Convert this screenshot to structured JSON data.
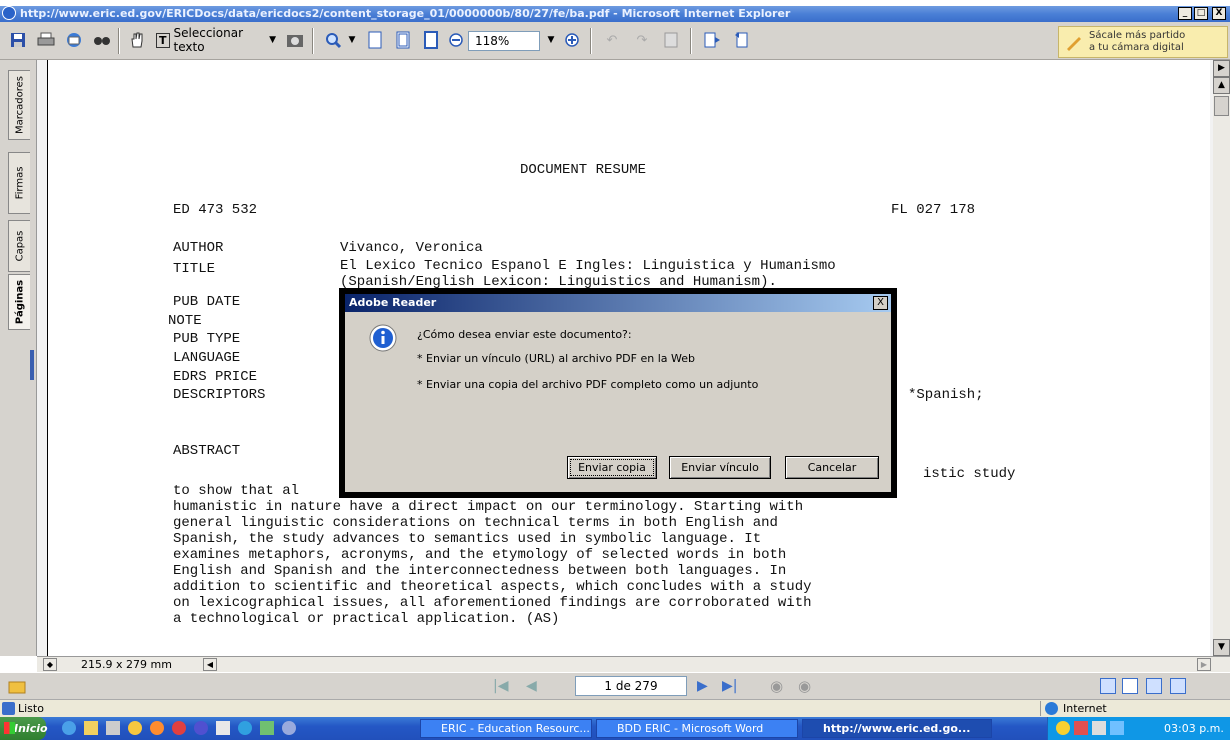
{
  "window": {
    "title": "http://www.eric.ed.gov/ERICDocs/data/ericdocs2/content_storage_01/0000000b/80/27/fe/ba.pdf - Microsoft Internet Explorer",
    "min": "_",
    "max": "□",
    "close": "X"
  },
  "toolbar": {
    "select_text": "Seleccionar texto",
    "zoom": "118%"
  },
  "promo": {
    "line1": "Sácale más partido",
    "line2": "a tu cámara digital"
  },
  "leftnav": {
    "tabs": [
      "Marcadores",
      "Firmas",
      "Capas",
      "Páginas"
    ]
  },
  "document": {
    "heading": "DOCUMENT RESUME",
    "ed_number": "ED 473 532",
    "fl_number": "FL 027 178",
    "fields": [
      {
        "label": "AUTHOR",
        "value": "Vivanco, Veronica"
      },
      {
        "label": "TITLE",
        "value": "El Lexico Tecnico Espanol E Ingles: Linguistica y Humanismo"
      },
      {
        "label": "",
        "value": "(Spanish/English Lexicon: Linguistics and Humanism)."
      },
      {
        "label": "PUB DATE",
        "value": ""
      },
      {
        "label": "NOTE",
        "value": ""
      },
      {
        "label": "PUB TYPE",
        "value": ""
      },
      {
        "label": "LANGUAGE",
        "value": ""
      },
      {
        "label": "EDRS PRICE",
        "value": ""
      },
      {
        "label": "DESCRIPTORS",
        "value": "*Spanish;"
      }
    ],
    "abstract_label": "ABSTRACT",
    "abstract_partial": "istic study",
    "abstract_lines": [
      "to show that al                                          or",
      "humanistic in nature have a direct impact on our terminology. Starting with",
      "general linguistic considerations on technical terms in both English and",
      "Spanish, the study advances to semantics used in symbolic language. It",
      "examines metaphors, acronyms, and the etymology of selected words in both",
      "English and Spanish and the interconnectedness between both languages. In",
      "addition to scientific and theoretical aspects, which concludes with a study",
      "on lexicographical issues, all aforementioned findings are corroborated with",
      "a technological or practical application. (AS)"
    ]
  },
  "dialog": {
    "title": "Adobe Reader",
    "close": "X",
    "question": "¿Cómo desea enviar este documento?:",
    "options": [
      "* Enviar un vínculo (URL) al archivo PDF en la Web",
      "* Enviar una copia del archivo PDF completo como un adjunto"
    ],
    "buttons": [
      "Enviar copia",
      "Enviar vínculo",
      "Cancelar"
    ]
  },
  "status": {
    "page_size": "215.9 x 279 mm",
    "page_indicator": "1 de 279",
    "ie_status": "Listo",
    "zone": "Internet"
  },
  "taskbar": {
    "start": "Inicio",
    "tasks": [
      "ERIC - Education Resourc...",
      "BDD ERIC - Microsoft Word",
      "http://www.eric.ed.go..."
    ],
    "clock": "03:03 p.m."
  },
  "colors": {
    "titlebar": "#3a6ecb",
    "taskbar": "#2457c5",
    "dialog_bg": "#d4d0c8"
  }
}
